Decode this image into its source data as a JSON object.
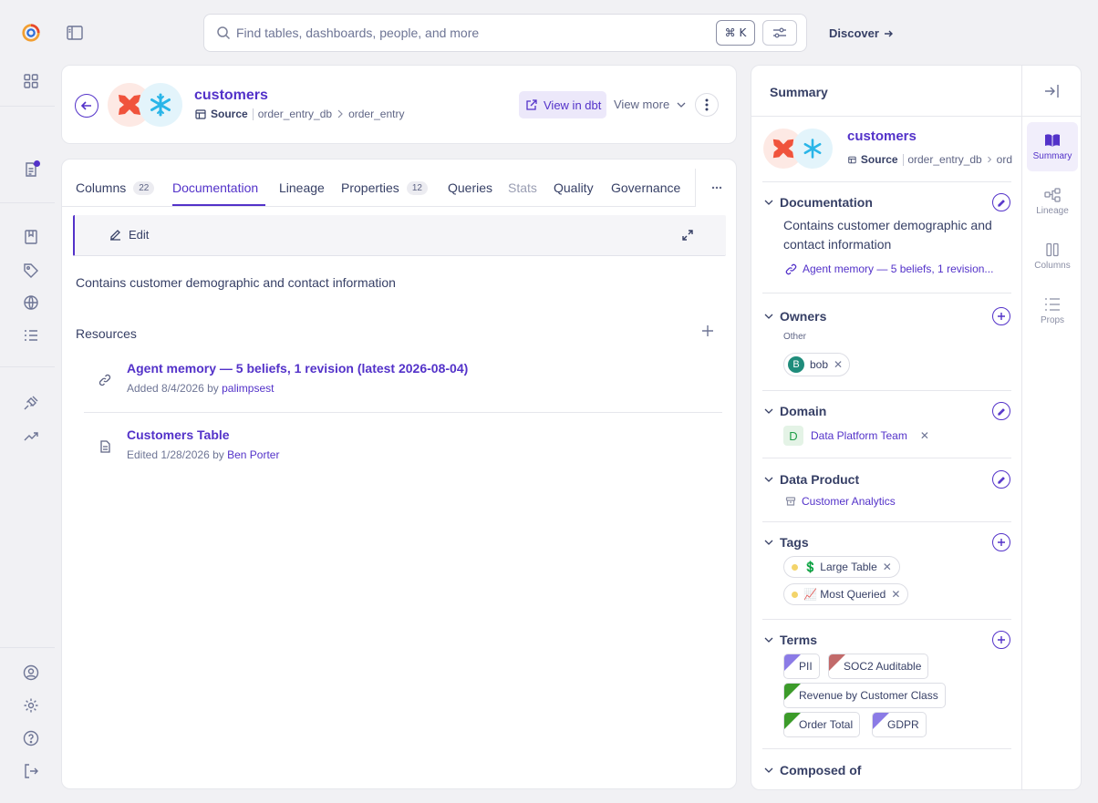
{
  "search": {
    "placeholder": "Find tables, dashboards, people, and more",
    "shortcut": "⌘ K"
  },
  "nav": {
    "discover": "Discover"
  },
  "header": {
    "name": "customers",
    "kind": "Source",
    "crumbs": [
      "order_entry_db",
      "order_entry"
    ],
    "view_in_dbt": "View in dbt",
    "view_more": "View more"
  },
  "tabs": [
    {
      "label": "Columns",
      "count": "22"
    },
    {
      "label": "Documentation"
    },
    {
      "label": "Lineage"
    },
    {
      "label": "Properties",
      "count": "12"
    },
    {
      "label": "Queries"
    },
    {
      "label": "Stats"
    },
    {
      "label": "Quality"
    },
    {
      "label": "Governance"
    }
  ],
  "doc": {
    "edit_label": "Edit",
    "text": "Contains customer demographic and contact information",
    "resources_title": "Resources",
    "resources": [
      {
        "title": "Agent memory — 5 beliefs, 1 revision (latest 2026-08-04)",
        "meta_prefix": "Added 8/4/2026 by",
        "user": "palimpsest"
      },
      {
        "title": "Customers Table",
        "meta_prefix": "Edited 1/28/2026 by",
        "user": "Ben Porter"
      }
    ]
  },
  "summary": {
    "title": "Summary",
    "name": "customers",
    "kind": "Source",
    "crumbs": [
      "order_entry_db",
      "ord"
    ],
    "documentation": {
      "title": "Documentation",
      "text": "Contains customer demographic and contact information",
      "link": "Agent memory — 5 beliefs, 1 revision..."
    },
    "owners": {
      "title": "Owners",
      "group": "Other",
      "owner_initial": "B",
      "owner": "bob"
    },
    "domain": {
      "title": "Domain",
      "initial": "D",
      "name": "Data Platform Team"
    },
    "data_product": {
      "title": "Data Product",
      "name": "Customer Analytics"
    },
    "tags": {
      "title": "Tags",
      "items": [
        "💲 Large Table",
        "📈 Most Queried"
      ]
    },
    "terms": {
      "title": "Terms",
      "items": [
        {
          "label": "PII",
          "color": "#8b7be6"
        },
        {
          "label": "SOC2 Auditable",
          "color": "#c26a6a"
        },
        {
          "label": "Revenue by Customer Class",
          "color": "#3c9b2a"
        },
        {
          "label": "Order Total",
          "color": "#3c9b2a"
        },
        {
          "label": "GDPR",
          "color": "#8b7be6"
        }
      ]
    },
    "composed_of": {
      "title": "Composed of"
    }
  },
  "side_tabs": [
    "Summary",
    "Lineage",
    "Columns",
    "Props"
  ],
  "colors": {
    "accent": "#5332c9",
    "text": "#374066",
    "background": "#f1f1f4"
  }
}
